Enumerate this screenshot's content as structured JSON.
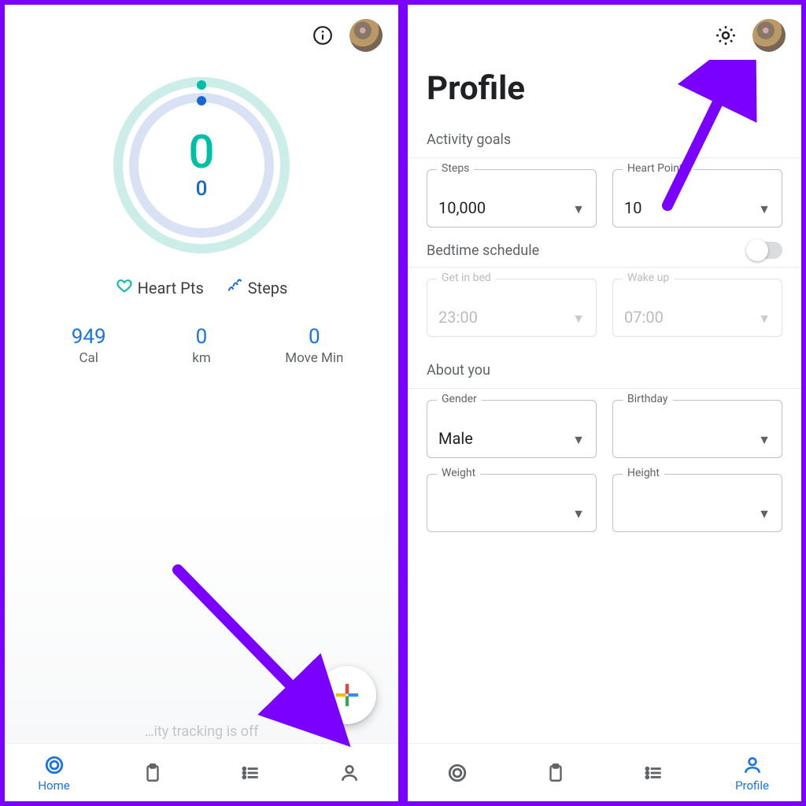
{
  "colors": {
    "teal": "#00bfa5",
    "blue": "#1a73e8",
    "arrow": "#7a00ff"
  },
  "home": {
    "ring": {
      "primary": "0",
      "secondary": "0"
    },
    "legend": {
      "heart": "Heart Pts",
      "steps": "Steps"
    },
    "stats": [
      {
        "value": "949",
        "unit": "Cal"
      },
      {
        "value": "0",
        "unit": "km"
      },
      {
        "value": "0",
        "unit": "Move Min"
      }
    ],
    "tracking_off": "…ity tracking is off",
    "nav": {
      "home": "Home",
      "journal": "",
      "browse": "",
      "profile": ""
    }
  },
  "profile": {
    "title": "Profile",
    "sections": {
      "activity": "Activity goals",
      "bedtime": "Bedtime schedule",
      "about": "About you"
    },
    "fields": {
      "steps": {
        "label": "Steps",
        "value": "10,000"
      },
      "heart": {
        "label": "Heart Points",
        "value": "10"
      },
      "get_in_bed": {
        "label": "Get in bed",
        "value": "23:00"
      },
      "wake_up": {
        "label": "Wake up",
        "value": "07:00"
      },
      "gender": {
        "label": "Gender",
        "value": "Male"
      },
      "birthday": {
        "label": "Birthday",
        "value": ""
      },
      "weight": {
        "label": "Weight",
        "value": ""
      },
      "height": {
        "label": "Height",
        "value": ""
      }
    },
    "nav": {
      "home": "",
      "journal": "",
      "browse": "",
      "profile": "Profile"
    }
  }
}
